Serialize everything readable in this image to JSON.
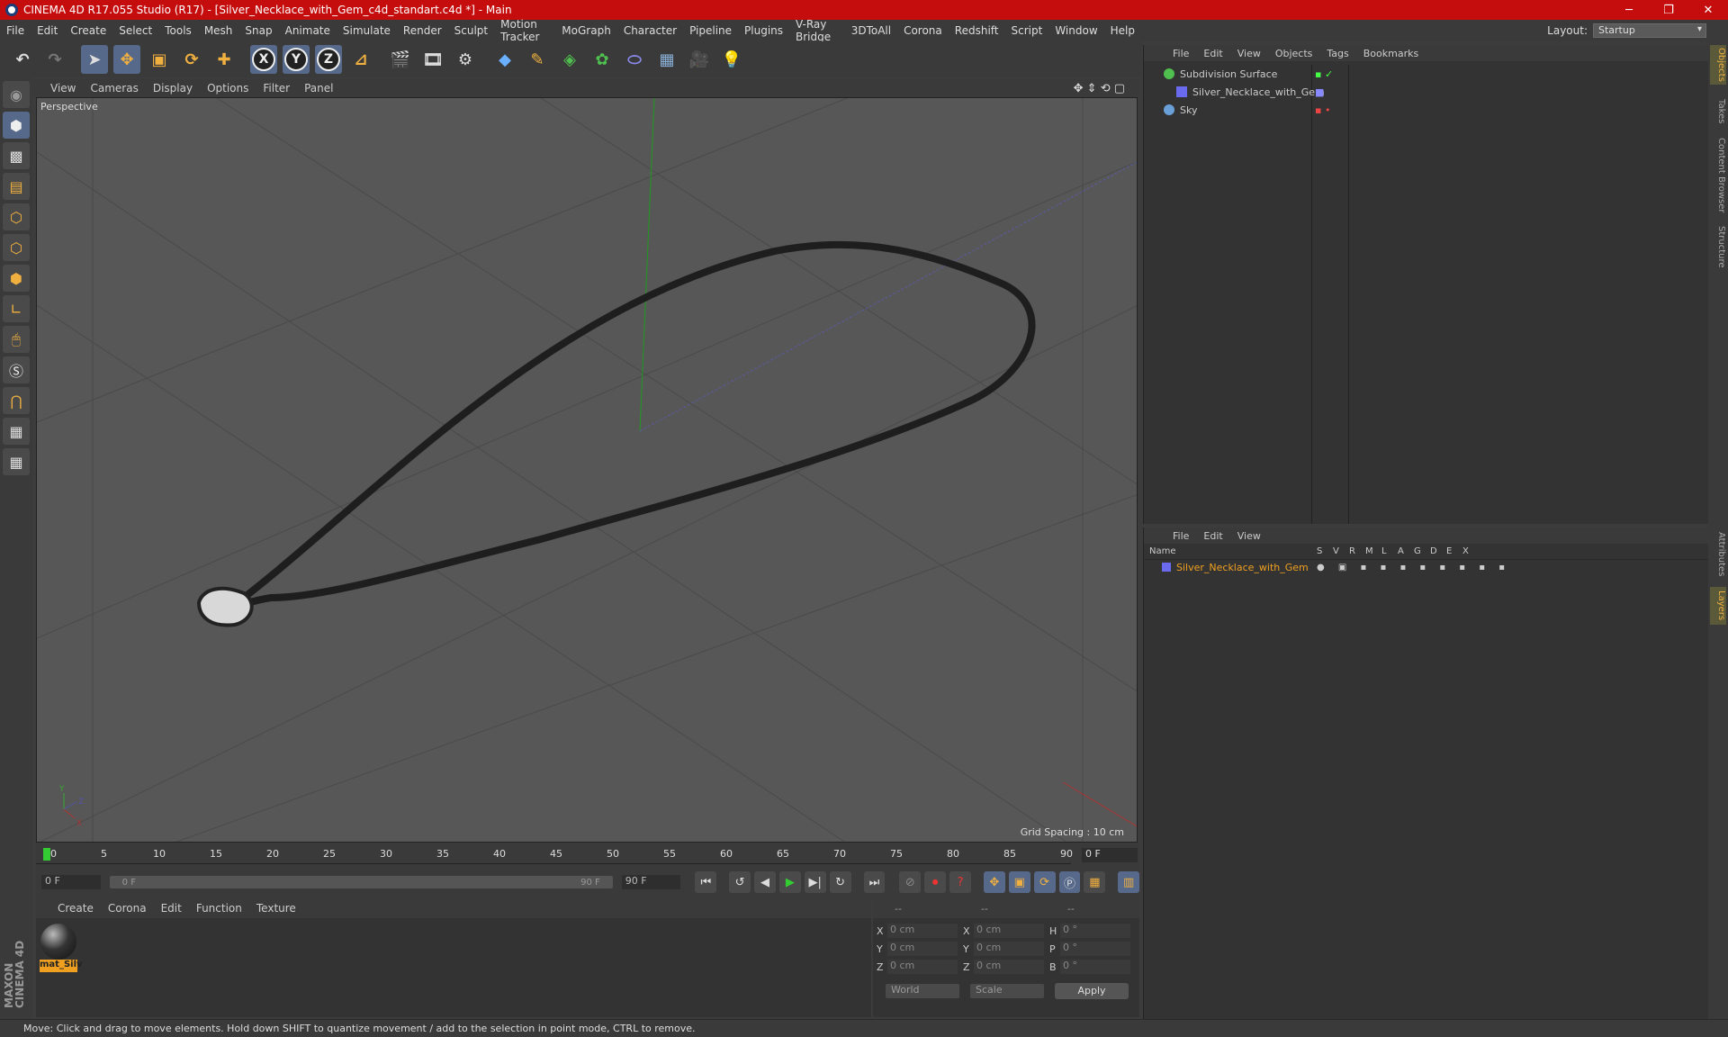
{
  "window": {
    "title": "CINEMA 4D R17.055 Studio (R17) - [Silver_Necklace_with_Gem_c4d_standart.c4d *] - Main"
  },
  "menu": [
    "File",
    "Edit",
    "Create",
    "Select",
    "Tools",
    "Mesh",
    "Snap",
    "Animate",
    "Simulate",
    "Render",
    "Sculpt",
    "Motion Tracker",
    "MoGraph",
    "Character",
    "Pipeline",
    "Plugins",
    "V-Ray Bridge",
    "3DToAll",
    "Corona",
    "Redshift",
    "Script",
    "Window",
    "Help"
  ],
  "layout": {
    "label": "Layout:",
    "value": "Startup"
  },
  "toolbar": {
    "x": "X",
    "y": "Y",
    "z": "Z"
  },
  "viewport": {
    "menu": [
      "View",
      "Cameras",
      "Display",
      "Options",
      "Filter",
      "Panel"
    ],
    "name": "Perspective",
    "grid_spacing": "Grid Spacing : 10 cm"
  },
  "timeline": {
    "ticks": [
      "0",
      "5",
      "10",
      "15",
      "20",
      "25",
      "30",
      "35",
      "40",
      "45",
      "50",
      "55",
      "60",
      "65",
      "70",
      "75",
      "80",
      "85",
      "90"
    ],
    "current": "0 F",
    "start": "0 F",
    "range_start": "0 F",
    "range_end": "90 F",
    "end": "90 F"
  },
  "materials": {
    "menu": [
      "Create",
      "Corona",
      "Edit",
      "Function",
      "Texture"
    ],
    "items": [
      {
        "name": "mat_Silv"
      }
    ]
  },
  "coords": {
    "headers": [
      "--",
      "--",
      "--"
    ],
    "rows": [
      {
        "a": "X",
        "av": "0 cm",
        "b": "X",
        "bv": "0 cm",
        "c": "H",
        "cv": "0 °"
      },
      {
        "a": "Y",
        "av": "0 cm",
        "b": "Y",
        "bv": "0 cm",
        "c": "P",
        "cv": "0 °"
      },
      {
        "a": "Z",
        "av": "0 cm",
        "b": "Z",
        "bv": "0 cm",
        "c": "B",
        "cv": "0 °"
      }
    ],
    "space": "World",
    "mode": "Scale",
    "apply": "Apply"
  },
  "objects": {
    "menu": [
      "File",
      "Edit",
      "View",
      "Objects",
      "Tags",
      "Bookmarks"
    ],
    "items": [
      {
        "name": "Subdivision Surface",
        "color": "#4fbf4f"
      },
      {
        "name": "Silver_Necklace_with_Gem",
        "color": "#6a6aee"
      },
      {
        "name": "Sky",
        "color": "#6aa0d8"
      }
    ]
  },
  "layers": {
    "menu": [
      "File",
      "Edit",
      "View"
    ],
    "cols": [
      "Name",
      "S",
      "V",
      "R",
      "M",
      "L",
      "A",
      "G",
      "D",
      "E",
      "X"
    ],
    "items": [
      {
        "name": "Silver_Necklace_with_Gem",
        "color": "#f0a020"
      }
    ]
  },
  "sidetabs": [
    "Objects",
    "Takes",
    "Content Browser",
    "Structure",
    "Attributes",
    "Layers"
  ],
  "status": "Move: Click and drag to move elements. Hold down SHIFT to quantize movement / add to the selection in point mode, CTRL to remove.",
  "brand": "MAXON CINEMA 4D"
}
